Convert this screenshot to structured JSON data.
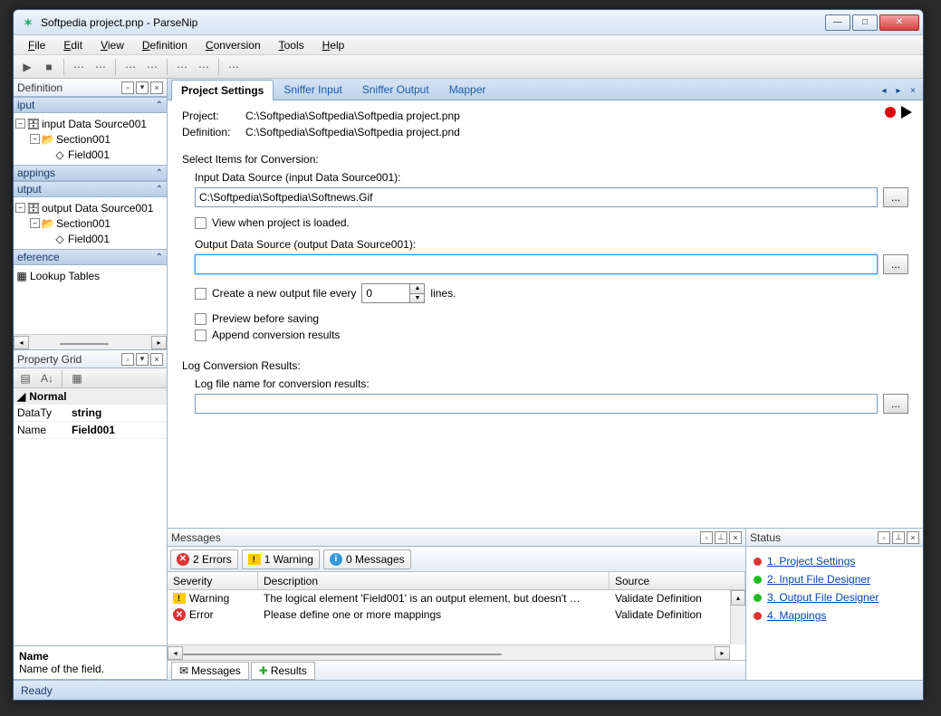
{
  "window": {
    "title": "Softpedia project.pnp - ParseNip"
  },
  "menu": {
    "items": [
      "File",
      "Edit",
      "View",
      "Definition",
      "Conversion",
      "Tools",
      "Help"
    ]
  },
  "panes": {
    "definition": {
      "title": "Definition",
      "sect_input": "iput",
      "sect_mappings": "appings",
      "sect_output": "utput",
      "sect_reference": "eference",
      "input_root": "input Data Source001",
      "input_section": "Section001",
      "input_field": "Field001",
      "output_root": "output Data Source001",
      "output_section": "Section001",
      "output_field": "Field001",
      "lookup": "Lookup Tables"
    },
    "propgrid": {
      "title": "Property Grid",
      "cat": "Normal",
      "rows": [
        {
          "k": "DataTy",
          "v": "string"
        },
        {
          "k": "Name",
          "v": "Field001"
        }
      ],
      "desc_name": "Name",
      "desc_text": "Name of the field."
    }
  },
  "tabs": {
    "items": [
      "Project Settings",
      "Sniffer Input",
      "Sniffer Output",
      "Mapper"
    ],
    "active": 0
  },
  "form": {
    "project_lbl": "Project:",
    "project_val": "C:\\Softpedia\\Softpedia\\Softpedia project.pnp",
    "definition_lbl": "Definition:",
    "definition_val": "C:\\Softpedia\\Softpedia\\Softpedia project.pnd",
    "select_items": "Select Items for Conversion:",
    "input_ds_lbl": "Input Data Source (input Data Source001):",
    "input_ds_val": "C:\\Softpedia\\Softpedia\\Softnews.Gif",
    "view_loaded": "View when project is loaded.",
    "output_ds_lbl": "Output Data Source (output Data Source001):",
    "output_ds_val": "",
    "create_every": "Create a new output file every",
    "every_count": "0",
    "lines": "lines.",
    "preview": "Preview before saving",
    "append": "Append conversion  results",
    "log_hdr": "Log Conversion Results:",
    "log_lbl": "Log file name for conversion results:",
    "browse": "..."
  },
  "messages": {
    "title": "Messages",
    "errors_btn": "2 Errors",
    "warn_btn": "1 Warning",
    "msg_btn": "0 Messages",
    "cols": {
      "sev": "Severity",
      "desc": "Description",
      "src": "Source"
    },
    "rows": [
      {
        "sev": "Warning",
        "icon": "warn",
        "desc": "The logical element 'Field001' is an output element, but doesn't …",
        "src": "Validate Definition"
      },
      {
        "sev": "Error",
        "icon": "err",
        "desc": "Please define one or more mappings",
        "src": "Validate Definition"
      }
    ],
    "tab_msgs": "Messages",
    "tab_results": "Results"
  },
  "status_pane": {
    "title": "Status",
    "items": [
      {
        "color": "#d33",
        "label": "1. Project Settings"
      },
      {
        "color": "#2b2",
        "label": "2. Input File Designer"
      },
      {
        "color": "#2b2",
        "label": "3. Output File Designer"
      },
      {
        "color": "#d33",
        "label": "4. Mappings"
      }
    ]
  },
  "statusbar": "Ready"
}
